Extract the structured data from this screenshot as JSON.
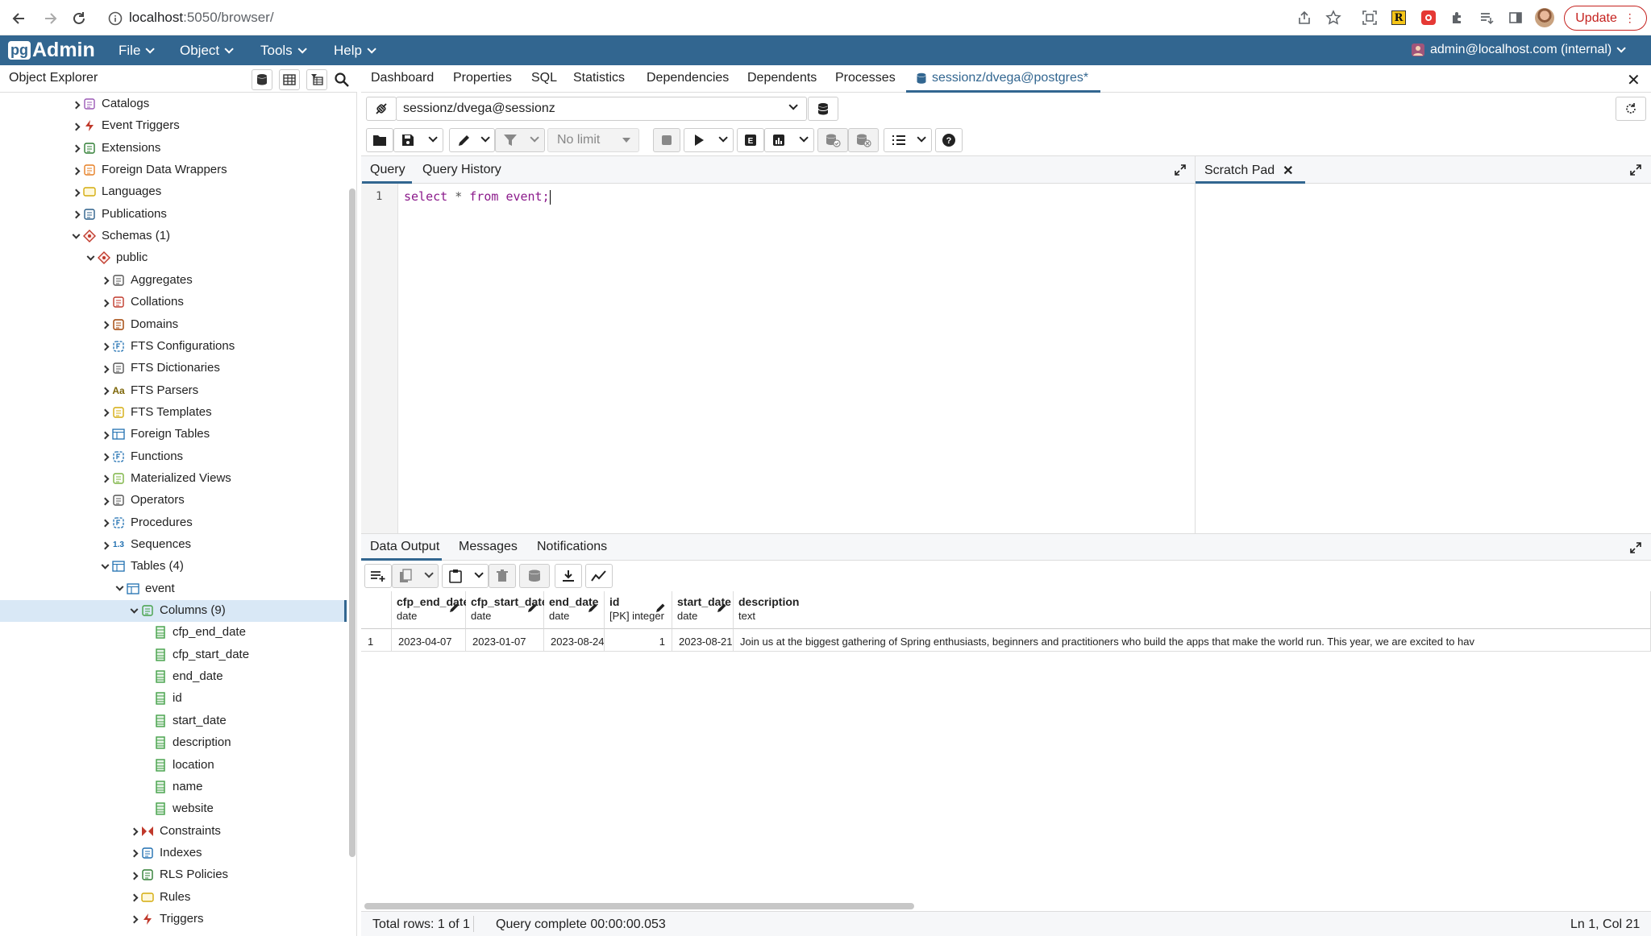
{
  "browser": {
    "url_host": "localhost",
    "url_rest": ":5050/browser/",
    "update_label": "Update"
  },
  "menubar": {
    "logo_pg": "pg",
    "logo_text": "Admin",
    "items": [
      "File",
      "Object",
      "Tools",
      "Help"
    ],
    "user": "admin@localhost.com (internal)"
  },
  "object_explorer": {
    "title": "Object Explorer",
    "tree": [
      {
        "label": "Catalogs",
        "icon": "catalog-icon",
        "level": 0,
        "state": "collapsed"
      },
      {
        "label": "Event Triggers",
        "icon": "event-trigger-icon",
        "level": 0,
        "state": "collapsed"
      },
      {
        "label": "Extensions",
        "icon": "extension-icon",
        "level": 0,
        "state": "collapsed"
      },
      {
        "label": "Foreign Data Wrappers",
        "icon": "fdw-icon",
        "level": 0,
        "state": "collapsed"
      },
      {
        "label": "Languages",
        "icon": "language-icon",
        "level": 0,
        "state": "collapsed"
      },
      {
        "label": "Publications",
        "icon": "publication-icon",
        "level": 0,
        "state": "collapsed"
      },
      {
        "label": "Schemas (1)",
        "icon": "schema-icon",
        "level": 0,
        "state": "expanded"
      },
      {
        "label": "public",
        "icon": "schema-public-icon",
        "level": 1,
        "state": "expanded"
      },
      {
        "label": "Aggregates",
        "icon": "aggregate-icon",
        "level": 2,
        "state": "collapsed"
      },
      {
        "label": "Collations",
        "icon": "collation-icon",
        "level": 2,
        "state": "collapsed"
      },
      {
        "label": "Domains",
        "icon": "domain-icon",
        "level": 2,
        "state": "collapsed"
      },
      {
        "label": "FTS Configurations",
        "icon": "fts-config-icon",
        "level": 2,
        "state": "collapsed"
      },
      {
        "label": "FTS Dictionaries",
        "icon": "fts-dictionary-icon",
        "level": 2,
        "state": "collapsed"
      },
      {
        "label": "FTS Parsers",
        "icon": "fts-parser-icon",
        "level": 2,
        "state": "collapsed"
      },
      {
        "label": "FTS Templates",
        "icon": "fts-template-icon",
        "level": 2,
        "state": "collapsed"
      },
      {
        "label": "Foreign Tables",
        "icon": "foreign-table-icon",
        "level": 2,
        "state": "collapsed"
      },
      {
        "label": "Functions",
        "icon": "function-icon",
        "level": 2,
        "state": "collapsed"
      },
      {
        "label": "Materialized Views",
        "icon": "materialized-view-icon",
        "level": 2,
        "state": "collapsed"
      },
      {
        "label": "Operators",
        "icon": "operator-icon",
        "level": 2,
        "state": "collapsed"
      },
      {
        "label": "Procedures",
        "icon": "procedure-icon",
        "level": 2,
        "state": "collapsed"
      },
      {
        "label": "Sequences",
        "icon": "sequence-icon",
        "level": 2,
        "state": "collapsed"
      },
      {
        "label": "Tables (4)",
        "icon": "tables-icon",
        "level": 2,
        "state": "expanded"
      },
      {
        "label": "event",
        "icon": "table-icon",
        "level": 3,
        "state": "expanded"
      },
      {
        "label": "Columns (9)",
        "icon": "columns-icon",
        "level": 4,
        "state": "expanded",
        "selected": true
      },
      {
        "label": "cfp_end_date",
        "icon": "column-icon",
        "level": 5,
        "state": "leaf"
      },
      {
        "label": "cfp_start_date",
        "icon": "column-icon",
        "level": 5,
        "state": "leaf"
      },
      {
        "label": "end_date",
        "icon": "column-icon",
        "level": 5,
        "state": "leaf"
      },
      {
        "label": "id",
        "icon": "column-icon",
        "level": 5,
        "state": "leaf"
      },
      {
        "label": "start_date",
        "icon": "column-icon",
        "level": 5,
        "state": "leaf"
      },
      {
        "label": "description",
        "icon": "column-icon",
        "level": 5,
        "state": "leaf"
      },
      {
        "label": "location",
        "icon": "column-icon",
        "level": 5,
        "state": "leaf"
      },
      {
        "label": "name",
        "icon": "column-icon",
        "level": 5,
        "state": "leaf"
      },
      {
        "label": "website",
        "icon": "column-icon",
        "level": 5,
        "state": "leaf"
      },
      {
        "label": "Constraints",
        "icon": "constraint-icon",
        "level": 4,
        "state": "collapsed"
      },
      {
        "label": "Indexes",
        "icon": "index-icon",
        "level": 4,
        "state": "collapsed"
      },
      {
        "label": "RLS Policies",
        "icon": "rls-policy-icon",
        "level": 4,
        "state": "collapsed"
      },
      {
        "label": "Rules",
        "icon": "rule-icon",
        "level": 4,
        "state": "collapsed"
      },
      {
        "label": "Triggers",
        "icon": "trigger-icon",
        "level": 4,
        "state": "collapsed"
      }
    ]
  },
  "main_tabs": [
    "Dashboard",
    "Properties",
    "SQL",
    "Statistics",
    "Dependencies",
    "Dependents",
    "Processes",
    "sessionz/dvega@postgres*"
  ],
  "connection": {
    "value": "sessionz/dvega@sessionz"
  },
  "toolbar": {
    "limit": "No limit"
  },
  "editor_tabs": {
    "query": "Query",
    "history": "Query History",
    "scratch": "Scratch Pad"
  },
  "editor": {
    "line_number": "1",
    "code": {
      "kw1": "select",
      "op": "*",
      "kw2": "from",
      "table": "event;"
    }
  },
  "results_tabs": [
    "Data Output",
    "Messages",
    "Notifications"
  ],
  "grid": {
    "columns": [
      {
        "name": "cfp_end_date",
        "type": "date"
      },
      {
        "name": "cfp_start_date",
        "type": "date"
      },
      {
        "name": "end_date",
        "type": "date"
      },
      {
        "name": "id",
        "type": "[PK] integer"
      },
      {
        "name": "start_date",
        "type": "date"
      },
      {
        "name": "description",
        "type": "text"
      }
    ],
    "rows": [
      {
        "num": "1",
        "cells": [
          "2023-04-07",
          "2023-01-07",
          "2023-08-24",
          "1",
          "2023-08-21",
          "Join us at the biggest gathering of Spring enthusiasts, beginners and practitioners who build the apps that make the world run. This year, we are excited to hav"
        ]
      }
    ]
  },
  "status": {
    "rows": "Total rows: 1 of 1",
    "query": "Query complete 00:00:00.053",
    "cursor": "Ln 1, Col 21"
  },
  "colors": {
    "brand": "#326690",
    "update": "#c5221f"
  }
}
